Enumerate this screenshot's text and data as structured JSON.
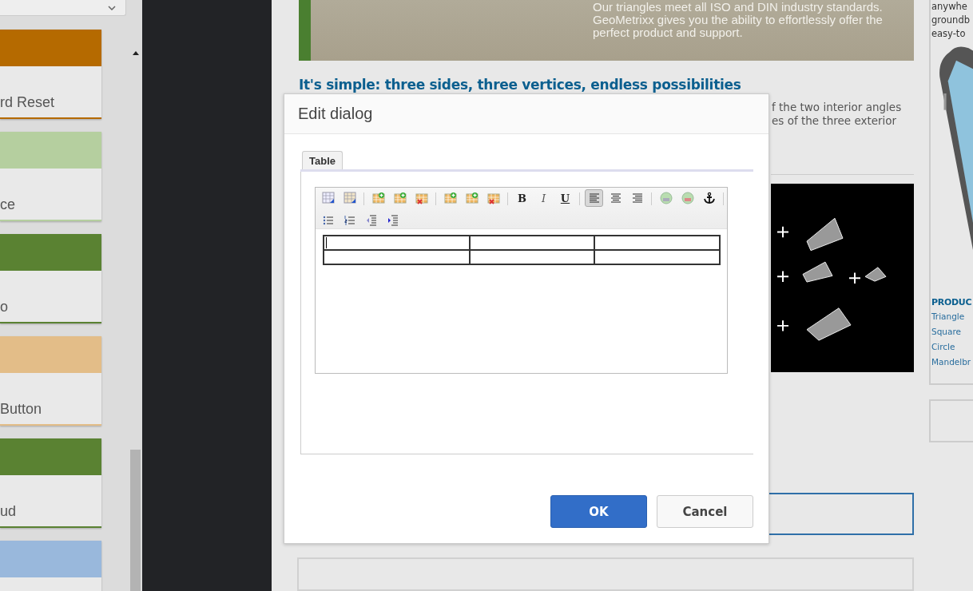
{
  "sidebar": {
    "cards": [
      {
        "label": "rd Reset",
        "color": "#b56a00"
      },
      {
        "label": "ce",
        "color": "#b5cf9f"
      },
      {
        "label": "o",
        "color": "#5a8232"
      },
      {
        "label": "Button",
        "color": "#e3bd88"
      },
      {
        "label": "ud",
        "color": "#5a8232"
      },
      {
        "color": "#99b8dc"
      }
    ]
  },
  "page": {
    "hero_lines": [
      "Our triangles meet all ISO and DIN industry standards.",
      "GeoMetrixx gives you the ability to effortlessly offer the",
      "perfect product and support."
    ],
    "heading": "It's simple: three sides, three vertices, endless possibilities",
    "paragraph_lines": [
      "f the two interior angles",
      "es of the three exterior"
    ],
    "side_lines": [
      "anywhe",
      "groundb",
      "easy-to"
    ],
    "products_heading": "PRODUC",
    "product_links": [
      "Triangle",
      "Square",
      "Circle",
      "Mandelbr"
    ]
  },
  "dialog": {
    "title": "Edit dialog",
    "tabs": [
      {
        "label": "Table",
        "selected": true
      }
    ],
    "toolbar": [
      [
        {
          "kind": "table-props",
          "selected": false
        },
        {
          "kind": "cell-props",
          "selected": false
        }
      ],
      [
        {
          "kind": "row-insert-above",
          "selected": false
        },
        {
          "kind": "row-insert-below",
          "selected": false
        },
        {
          "kind": "row-delete",
          "selected": false
        }
      ],
      [
        {
          "kind": "col-insert-left",
          "selected": false
        },
        {
          "kind": "col-insert-right",
          "selected": false
        },
        {
          "kind": "col-delete",
          "selected": false
        }
      ],
      [
        {
          "kind": "bold",
          "label": "B",
          "selected": false
        },
        {
          "kind": "italic",
          "label": "I",
          "selected": false
        },
        {
          "kind": "underline",
          "label": "U",
          "selected": false
        }
      ],
      [
        {
          "kind": "align-left",
          "selected": true
        },
        {
          "kind": "align-center",
          "selected": false
        },
        {
          "kind": "align-right",
          "selected": false
        }
      ],
      [
        {
          "kind": "link",
          "selected": false
        },
        {
          "kind": "unlink",
          "selected": false
        },
        {
          "kind": "anchor",
          "selected": false
        }
      ],
      [
        {
          "kind": "bullet-list",
          "selected": false
        },
        {
          "kind": "numbered-list",
          "selected": false
        },
        {
          "kind": "outdent",
          "selected": false
        },
        {
          "kind": "indent",
          "selected": false
        }
      ]
    ],
    "buttons": [
      {
        "label": "OK",
        "kind": "primary"
      },
      {
        "label": "Cancel",
        "kind": "secondary"
      }
    ]
  }
}
